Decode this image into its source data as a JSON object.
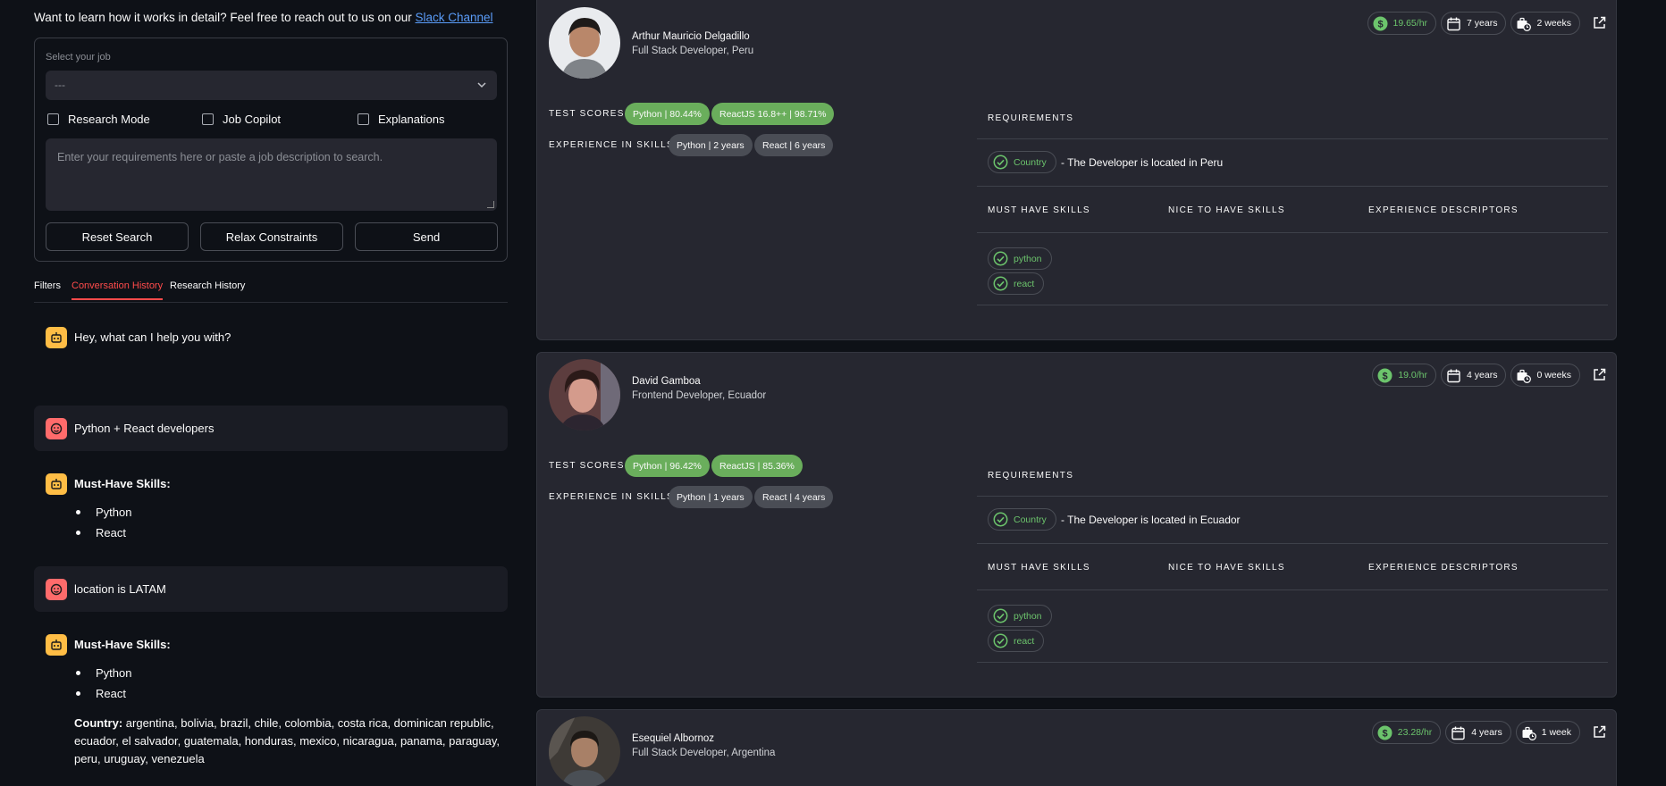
{
  "intro": {
    "text": "Want to learn how it works in detail? Feel free to reach out to us on our ",
    "link": "Slack Channel"
  },
  "form": {
    "select_label": "Select your job",
    "select_value": "---",
    "checkboxes": [
      "Research Mode",
      "Job Copilot",
      "Explanations"
    ],
    "textarea_placeholder": "Enter your requirements here or paste a job description to search.",
    "buttons": [
      "Reset Search",
      "Relax Constraints",
      "Send"
    ]
  },
  "tabs": {
    "items": [
      "Filters",
      "Conversation History",
      "Research History"
    ],
    "active": "Conversation History"
  },
  "chat": {
    "greeting": "Hey, what can I help you with?",
    "user1": "Python + React developers",
    "reply1": {
      "title": "Must-Have Skills:",
      "items": [
        "Python",
        "React"
      ]
    },
    "user2": "location is LATAM",
    "reply2": {
      "title": "Must-Have Skills:",
      "items": [
        "Python",
        "React"
      ],
      "country_label": "Country:",
      "country_values": " argentina, bolivia, brazil, chile, colombia, costa rica, dominican republic, ecuador, el salvador, guatemala, honduras, mexico, nicaragua, panama, paraguay, peru, uruguay, venezuela"
    }
  },
  "card_labels": {
    "test_scores": "TEST SCORES:",
    "experience": "EXPERIENCE IN SKILLS:",
    "requirements": "REQUIREMENTS",
    "country_tag": "Country",
    "must_have": "MUST HAVE SKILLS",
    "nice_to_have": "NICE TO HAVE SKILLS",
    "experience_descriptors": "EXPERIENCE DESCRIPTORS"
  },
  "candidates": [
    {
      "name": "Arthur Mauricio Delgadillo",
      "role": "Full Stack Developer, Peru",
      "rate": "19.65/hr",
      "experience": "7 years",
      "availability": "2 weeks",
      "test_scores": [
        "Python | 80.44%",
        "ReactJS 16.8++ | 98.71%"
      ],
      "skills": [
        "Python | 2 years",
        "React | 6 years"
      ],
      "location_text": "- The Developer is located in Peru",
      "must_have": [
        "python",
        "react"
      ]
    },
    {
      "name": "David Gamboa",
      "role": "Frontend Developer, Ecuador",
      "rate": "19.0/hr",
      "experience": "4 years",
      "availability": "0 weeks",
      "test_scores": [
        "Python | 96.42%",
        "ReactJS | 85.36%"
      ],
      "skills": [
        "Python | 1 years",
        "React | 4 years"
      ],
      "location_text": "- The Developer is located in Ecuador",
      "must_have": [
        "python",
        "react"
      ]
    },
    {
      "name": "Esequiel Albornoz",
      "role": "Full Stack Developer, Argentina",
      "rate": "23.28/hr",
      "experience": "4 years",
      "availability": "1 week"
    }
  ],
  "colors": {
    "accent": "#ff4b4b",
    "green": "#6cc46c",
    "pill_green": "#6aae5c",
    "bot_avatar": "#ffbd45",
    "user_avatar": "#ff6b6b"
  }
}
